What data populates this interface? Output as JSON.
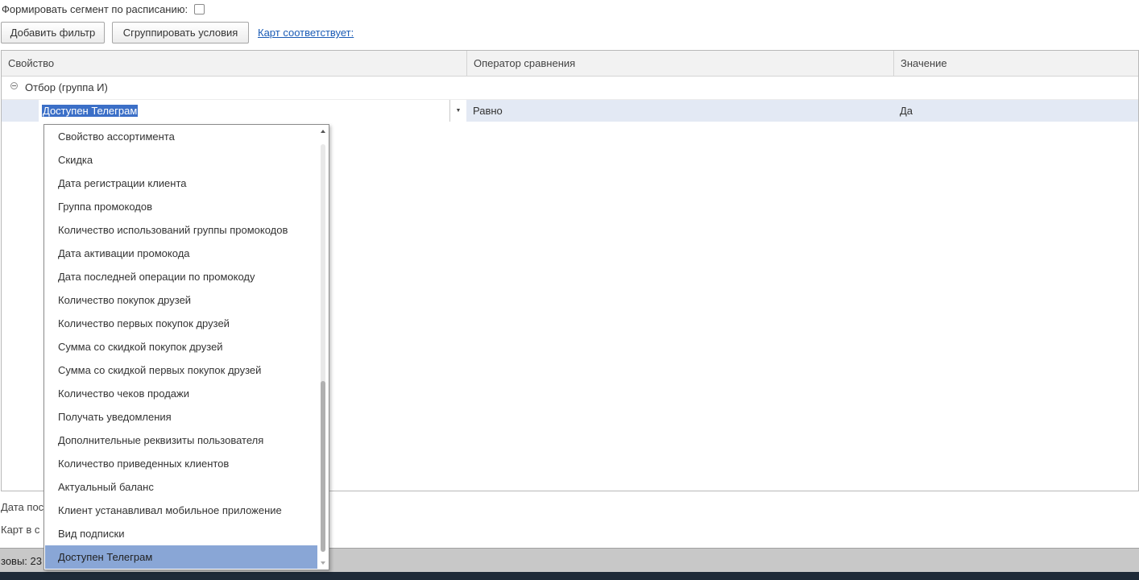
{
  "schedule": {
    "label": "Формировать сегмент по расписанию:",
    "checked": false
  },
  "toolbar": {
    "add_filter_label": "Добавить фильтр",
    "group_conditions_label": "Сгруппировать условия",
    "cards_match_link": "Карт соответствует:"
  },
  "grid": {
    "columns": [
      "Свойство",
      "Оператор сравнения",
      "Значение"
    ],
    "group_label": "Отбор (группа И)",
    "row": {
      "property": "Доступен Телеграм",
      "operator": "Равно",
      "value": "Да"
    }
  },
  "dropdown": {
    "items": [
      "Свойство ассортимента",
      "Скидка",
      "Дата регистрации клиента",
      "Группа промокодов",
      "Количество использований группы промокодов",
      "Дата активации промокода",
      "Дата последней операции по промокоду",
      "Количество покупок друзей",
      "Количество первых покупок друзей",
      "Сумма со скидкой покупок друзей",
      "Сумма со скидкой первых покупок друзей",
      "Количество чеков продажи",
      "Получать уведомления",
      "Дополнительные реквизиты пользователя",
      "Количество приведенных клиентов",
      "Актуальный баланс",
      "Клиент устанавливал мобильное приложение",
      "Вид подписки",
      "Доступен Телеграм"
    ],
    "selected_index": 18
  },
  "footer": {
    "line1": "Дата пос",
    "line2": "Карт в с",
    "status": "зовы: 23"
  },
  "icons": {
    "collapse": "collapse-minus-icon",
    "dropdown_arrow": "dropdown-arrow-icon"
  }
}
